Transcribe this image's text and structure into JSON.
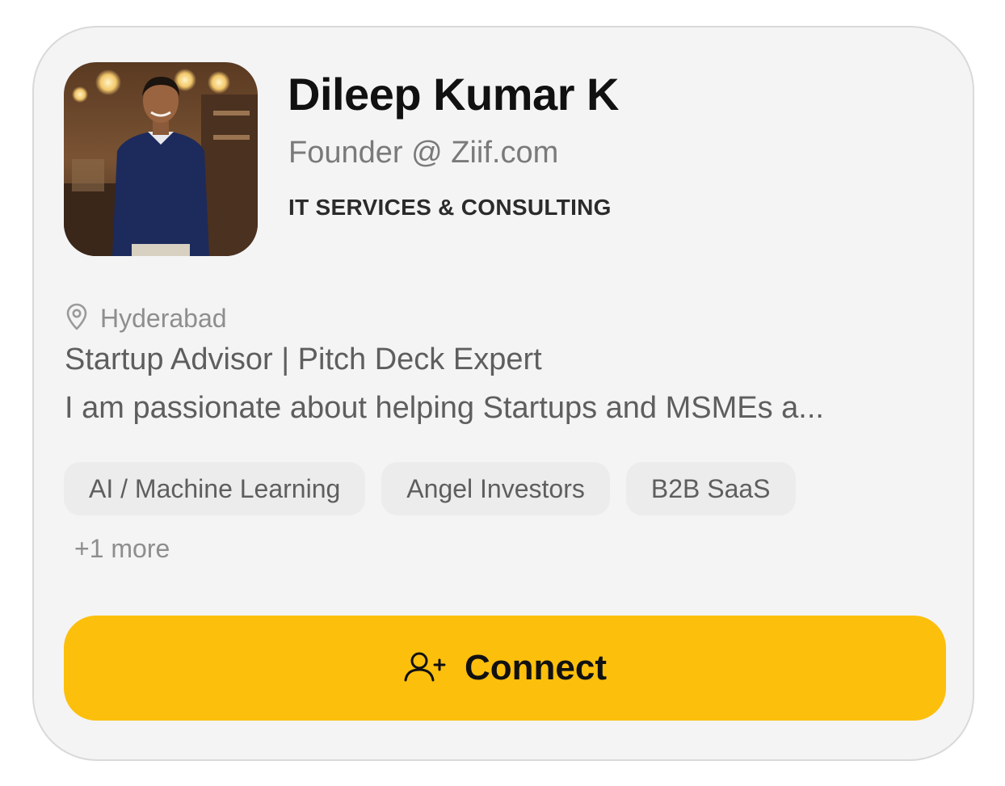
{
  "profile": {
    "name": "Dileep Kumar K",
    "role": "Founder @ Ziif.com",
    "industry": "IT SERVICES & CONSULTING",
    "location": "Hyderabad",
    "headline": "Startup Advisor | Pitch Deck Expert",
    "bio": "I am passionate about helping Startups and MSMEs a...",
    "tags": [
      "AI / Machine Learning",
      "Angel Investors",
      "B2B SaaS"
    ],
    "more_tags": "+1 more"
  },
  "actions": {
    "connect_label": "Connect"
  },
  "icons": {
    "location": "map-pin-icon",
    "connect": "user-plus-icon"
  },
  "colors": {
    "accent": "#fcbf0c",
    "card_background": "#f4f4f4",
    "tag_background": "#ececec"
  }
}
